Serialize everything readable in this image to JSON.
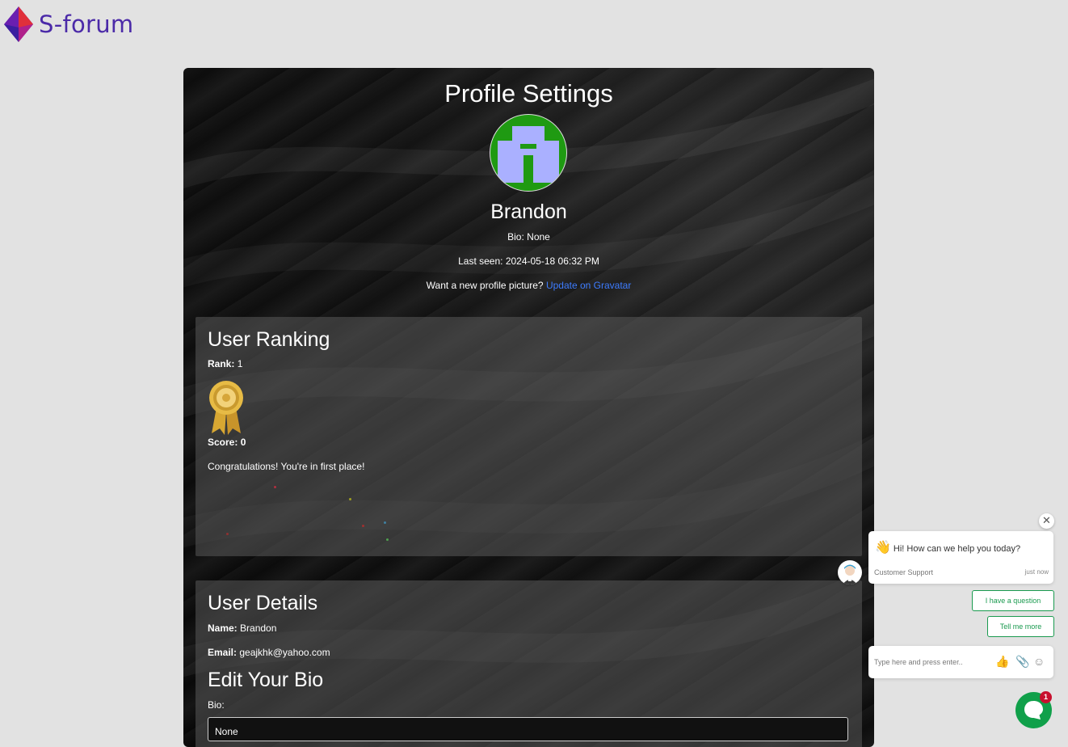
{
  "brand": {
    "name": "S-forum"
  },
  "profile": {
    "title": "Profile Settings",
    "username": "Brandon",
    "bio_label": "Bio:",
    "bio_value": "None",
    "last_seen_label": "Last seen:",
    "last_seen_value": "2024-05-18 06:32 PM",
    "picture_prompt": "Want a new profile picture?",
    "gravatar_link": "Update on Gravatar"
  },
  "ranking": {
    "heading": "User Ranking",
    "rank_label": "Rank:",
    "rank_value": "1",
    "score_label": "Score:",
    "score_value": "0",
    "message": "Congratulations! You're in first place!",
    "medal_icon": "gold-rosette-medal"
  },
  "details": {
    "heading": "User Details",
    "name_label": "Name:",
    "name_value": "Brandon",
    "email_label": "Email:",
    "email_value": "geajkhk@yahoo.com",
    "edit_heading": "Edit Your Bio",
    "bio_field_label": "Bio:",
    "bio_field_value": "None"
  },
  "chat": {
    "greeting": "Hi! How can we help you today?",
    "agent": "Customer Support",
    "time": "just now",
    "quick_replies": [
      "I have a question",
      "Tell me more"
    ],
    "input_placeholder": "Type here and press enter..",
    "unread_count": "1",
    "accent_color": "#10a04a"
  },
  "colors": {
    "background": "#e2e2e2",
    "panel": "#0d0d0d",
    "link": "#3d7cff",
    "avatar_bg": "#1f9a12",
    "avatar_fg": "#aab0ff"
  }
}
